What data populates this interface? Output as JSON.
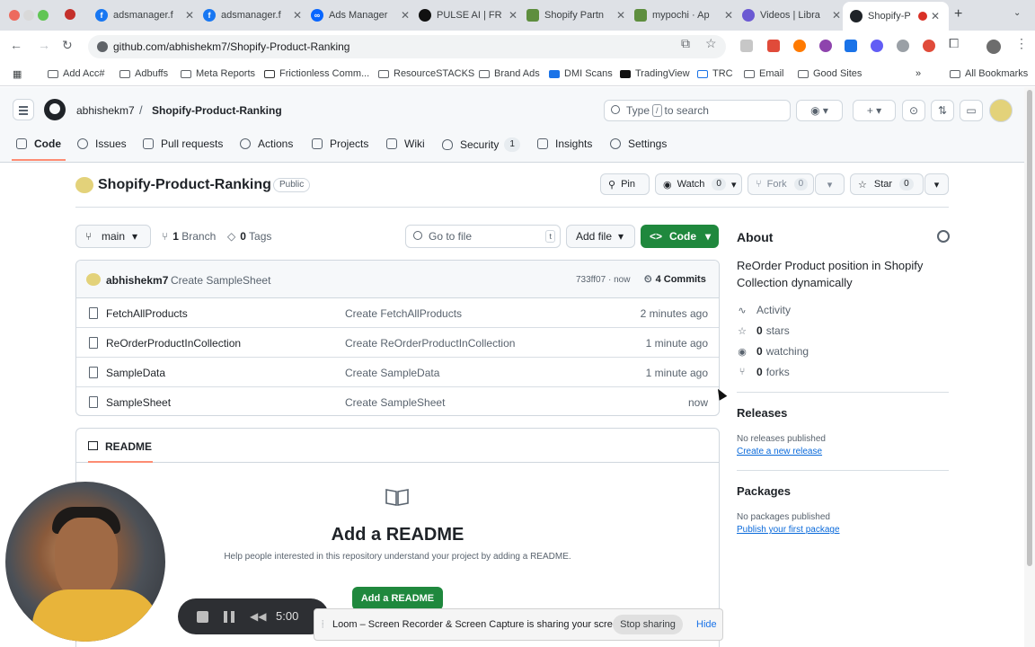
{
  "browser": {
    "tabs": [
      {
        "label": "adsmanager.f",
        "icon": "facebook-icon",
        "color": "#1877f2"
      },
      {
        "label": "adsmanager.f",
        "icon": "facebook-icon",
        "color": "#1877f2"
      },
      {
        "label": "Ads Manager",
        "icon": "meta-icon",
        "color": "#0866ff"
      },
      {
        "label": "PULSE AI | FR",
        "icon": "pulse-icon",
        "color": "#111111"
      },
      {
        "label": "Shopify Partn",
        "icon": "shopify-icon",
        "color": "#5e8e3e"
      },
      {
        "label": "mypochi · Ap",
        "icon": "shopify-icon",
        "color": "#5e8e3e"
      },
      {
        "label": "Videos | Libra",
        "icon": "gear-icon",
        "color": "#6b59d3"
      },
      {
        "label": "Shopify-P",
        "icon": "github-icon",
        "color": "#1f2328"
      }
    ],
    "url": "github.com/abhishekm7/Shopify-Product-Ranking",
    "bookmarks": [
      "Add Acc#",
      "Adbuffs",
      "Meta Reports",
      "Frictionless Comm...",
      "ResourceSTACKS",
      "Brand Ads",
      "DMI Scans",
      "TradingView",
      "TRC",
      "Email",
      "Good Sites"
    ],
    "all_bookmarks": "All Bookmarks"
  },
  "header": {
    "owner": "abhishekm7",
    "separator": "/",
    "repo": "Shopify-Product-Ranking",
    "search_prefix": "Type",
    "search_key": "/",
    "search_suffix": "to search",
    "tabs": [
      {
        "label": "Code",
        "count": ""
      },
      {
        "label": "Issues",
        "count": ""
      },
      {
        "label": "Pull requests",
        "count": ""
      },
      {
        "label": "Actions",
        "count": ""
      },
      {
        "label": "Projects",
        "count": ""
      },
      {
        "label": "Wiki",
        "count": ""
      },
      {
        "label": "Security",
        "count": "1"
      },
      {
        "label": "Insights",
        "count": ""
      },
      {
        "label": "Settings",
        "count": ""
      }
    ]
  },
  "repo": {
    "name": "Shopify-Product-Ranking",
    "visibility": "Public",
    "pin": "Pin",
    "watch": "Watch",
    "watch_count": "0",
    "fork": "Fork",
    "fork_count": "0",
    "star": "Star",
    "star_count": "0"
  },
  "branchbar": {
    "branch": "main",
    "branches_num": "1",
    "branches_label": "Branch",
    "tags_num": "0",
    "tags_label": "Tags",
    "goto_placeholder": "Go to file",
    "goto_key": "t",
    "add_file": "Add file",
    "code": "Code"
  },
  "commit": {
    "author": "abhishekm7",
    "message": "Create SampleSheet",
    "sha": "733ff07 · now",
    "commits": "4 Commits"
  },
  "files": [
    {
      "name": "FetchAllProducts",
      "message": "Create FetchAllProducts",
      "time": "2 minutes ago"
    },
    {
      "name": "ReOrderProductInCollection",
      "message": "Create ReOrderProductInCollection",
      "time": "1 minute ago"
    },
    {
      "name": "SampleData",
      "message": "Create SampleData",
      "time": "1 minute ago"
    },
    {
      "name": "SampleSheet",
      "message": "Create SampleSheet",
      "time": "now"
    }
  ],
  "readme": {
    "tab": "README",
    "title": "Add a README",
    "description": "Help people interested in this repository understand your project by adding a README.",
    "button": "Add a README"
  },
  "about": {
    "heading": "About",
    "description": "ReOrder Product position in Shopify Collection dynamically",
    "activity": "Activity",
    "stars_num": "0",
    "stars": "stars",
    "watching_num": "0",
    "watching": "watching",
    "forks_num": "0",
    "forks": "forks"
  },
  "releases": {
    "heading": "Releases",
    "none": "No releases published",
    "link": "Create a new release"
  },
  "packages": {
    "heading": "Packages",
    "none": "No packages published",
    "link": "Publish your first package"
  },
  "loom": {
    "timer": "5:00",
    "message": "Loom – Screen Recorder & Screen Capture is sharing your screen.",
    "stop": "Stop sharing",
    "hide": "Hide"
  }
}
